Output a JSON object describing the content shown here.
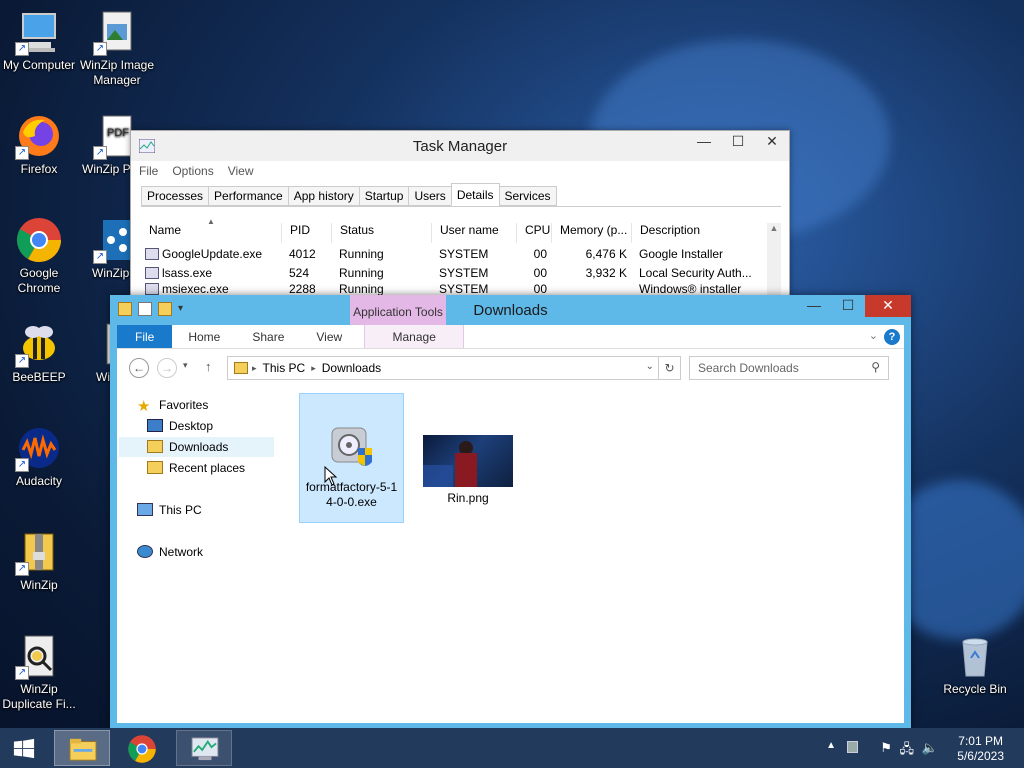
{
  "desktop": {
    "icons": [
      {
        "label": "My Computer"
      },
      {
        "label": "WinZip Image Manager"
      },
      {
        "label": "Firefox"
      },
      {
        "label": "WinZip PDF Express"
      },
      {
        "label": "Google Chrome"
      },
      {
        "label": "WinZip SafeShare"
      },
      {
        "label": "BeeBEEP"
      },
      {
        "label": "WinZip Secure"
      },
      {
        "label": "Audacity"
      },
      {
        "label": "WinZip"
      },
      {
        "label": "WinZip Duplicate Fi..."
      },
      {
        "label": "Recycle Bin"
      }
    ]
  },
  "taskmgr": {
    "title": "Task Manager",
    "menu": [
      "File",
      "Options",
      "View"
    ],
    "tabs": [
      "Processes",
      "Performance",
      "App history",
      "Startup",
      "Users",
      "Details",
      "Services"
    ],
    "active_tab": "Details",
    "columns": [
      "Name",
      "PID",
      "Status",
      "User name",
      "CPU",
      "Memory (p...",
      "Description"
    ],
    "rows": [
      {
        "name": "GoogleUpdate.exe",
        "pid": "4012",
        "status": "Running",
        "user": "SYSTEM",
        "cpu": "00",
        "mem": "6,476 K",
        "desc": "Google Installer"
      },
      {
        "name": "lsass.exe",
        "pid": "524",
        "status": "Running",
        "user": "SYSTEM",
        "cpu": "00",
        "mem": "3,932 K",
        "desc": "Local Security Auth..."
      },
      {
        "name": "msiexec.exe",
        "pid": "2288",
        "status": "Running",
        "user": "SYSTEM",
        "cpu": "00",
        "mem": "",
        "desc": "Windows® installer"
      }
    ]
  },
  "explorer": {
    "title": "Downloads",
    "context_tab": "Application Tools",
    "ribbon_tabs": [
      "File",
      "Home",
      "Share",
      "View",
      "Manage"
    ],
    "breadcrumb": [
      "This PC",
      "Downloads"
    ],
    "search_placeholder": "Search Downloads",
    "nav": {
      "favorites": "Favorites",
      "desktop": "Desktop",
      "downloads": "Downloads",
      "recent": "Recent places",
      "thispc": "This PC",
      "network": "Network"
    },
    "files": [
      {
        "name": "formatfactory-5-14-0-0.exe"
      },
      {
        "name": "Rin.png"
      }
    ]
  },
  "taskbar": {
    "time": "7:01 PM",
    "date": "5/6/2023"
  },
  "colors": {
    "explorer_frame": "#5eb8e8",
    "close_red": "#c7392b",
    "file_tab": "#1979ca",
    "context_tab": "#e3b8e6",
    "taskbar": "#223a5c"
  }
}
